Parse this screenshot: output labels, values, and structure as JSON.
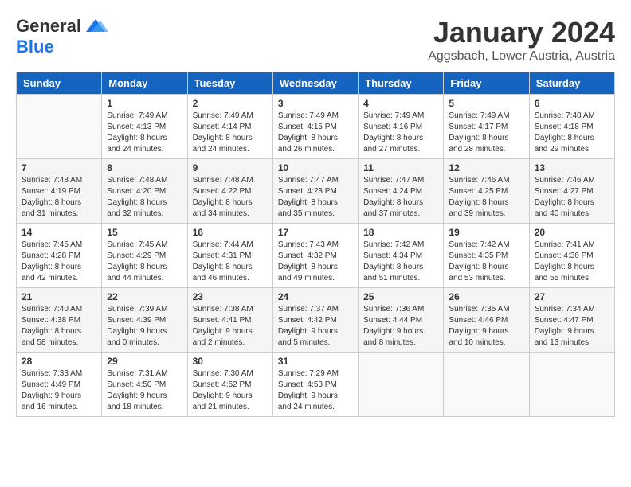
{
  "header": {
    "logo_general": "General",
    "logo_blue": "Blue",
    "month_title": "January 2024",
    "subtitle": "Aggsbach, Lower Austria, Austria"
  },
  "weekdays": [
    "Sunday",
    "Monday",
    "Tuesday",
    "Wednesday",
    "Thursday",
    "Friday",
    "Saturday"
  ],
  "weeks": [
    [
      {
        "day": "",
        "sunrise": "",
        "sunset": "",
        "daylight": ""
      },
      {
        "day": "1",
        "sunrise": "Sunrise: 7:49 AM",
        "sunset": "Sunset: 4:13 PM",
        "daylight": "Daylight: 8 hours and 24 minutes."
      },
      {
        "day": "2",
        "sunrise": "Sunrise: 7:49 AM",
        "sunset": "Sunset: 4:14 PM",
        "daylight": "Daylight: 8 hours and 24 minutes."
      },
      {
        "day": "3",
        "sunrise": "Sunrise: 7:49 AM",
        "sunset": "Sunset: 4:15 PM",
        "daylight": "Daylight: 8 hours and 26 minutes."
      },
      {
        "day": "4",
        "sunrise": "Sunrise: 7:49 AM",
        "sunset": "Sunset: 4:16 PM",
        "daylight": "Daylight: 8 hours and 27 minutes."
      },
      {
        "day": "5",
        "sunrise": "Sunrise: 7:49 AM",
        "sunset": "Sunset: 4:17 PM",
        "daylight": "Daylight: 8 hours and 28 minutes."
      },
      {
        "day": "6",
        "sunrise": "Sunrise: 7:48 AM",
        "sunset": "Sunset: 4:18 PM",
        "daylight": "Daylight: 8 hours and 29 minutes."
      }
    ],
    [
      {
        "day": "7",
        "sunrise": "Sunrise: 7:48 AM",
        "sunset": "Sunset: 4:19 PM",
        "daylight": "Daylight: 8 hours and 31 minutes."
      },
      {
        "day": "8",
        "sunrise": "Sunrise: 7:48 AM",
        "sunset": "Sunset: 4:20 PM",
        "daylight": "Daylight: 8 hours and 32 minutes."
      },
      {
        "day": "9",
        "sunrise": "Sunrise: 7:48 AM",
        "sunset": "Sunset: 4:22 PM",
        "daylight": "Daylight: 8 hours and 34 minutes."
      },
      {
        "day": "10",
        "sunrise": "Sunrise: 7:47 AM",
        "sunset": "Sunset: 4:23 PM",
        "daylight": "Daylight: 8 hours and 35 minutes."
      },
      {
        "day": "11",
        "sunrise": "Sunrise: 7:47 AM",
        "sunset": "Sunset: 4:24 PM",
        "daylight": "Daylight: 8 hours and 37 minutes."
      },
      {
        "day": "12",
        "sunrise": "Sunrise: 7:46 AM",
        "sunset": "Sunset: 4:25 PM",
        "daylight": "Daylight: 8 hours and 39 minutes."
      },
      {
        "day": "13",
        "sunrise": "Sunrise: 7:46 AM",
        "sunset": "Sunset: 4:27 PM",
        "daylight": "Daylight: 8 hours and 40 minutes."
      }
    ],
    [
      {
        "day": "14",
        "sunrise": "Sunrise: 7:45 AM",
        "sunset": "Sunset: 4:28 PM",
        "daylight": "Daylight: 8 hours and 42 minutes."
      },
      {
        "day": "15",
        "sunrise": "Sunrise: 7:45 AM",
        "sunset": "Sunset: 4:29 PM",
        "daylight": "Daylight: 8 hours and 44 minutes."
      },
      {
        "day": "16",
        "sunrise": "Sunrise: 7:44 AM",
        "sunset": "Sunset: 4:31 PM",
        "daylight": "Daylight: 8 hours and 46 minutes."
      },
      {
        "day": "17",
        "sunrise": "Sunrise: 7:43 AM",
        "sunset": "Sunset: 4:32 PM",
        "daylight": "Daylight: 8 hours and 49 minutes."
      },
      {
        "day": "18",
        "sunrise": "Sunrise: 7:42 AM",
        "sunset": "Sunset: 4:34 PM",
        "daylight": "Daylight: 8 hours and 51 minutes."
      },
      {
        "day": "19",
        "sunrise": "Sunrise: 7:42 AM",
        "sunset": "Sunset: 4:35 PM",
        "daylight": "Daylight: 8 hours and 53 minutes."
      },
      {
        "day": "20",
        "sunrise": "Sunrise: 7:41 AM",
        "sunset": "Sunset: 4:36 PM",
        "daylight": "Daylight: 8 hours and 55 minutes."
      }
    ],
    [
      {
        "day": "21",
        "sunrise": "Sunrise: 7:40 AM",
        "sunset": "Sunset: 4:38 PM",
        "daylight": "Daylight: 8 hours and 58 minutes."
      },
      {
        "day": "22",
        "sunrise": "Sunrise: 7:39 AM",
        "sunset": "Sunset: 4:39 PM",
        "daylight": "Daylight: 9 hours and 0 minutes."
      },
      {
        "day": "23",
        "sunrise": "Sunrise: 7:38 AM",
        "sunset": "Sunset: 4:41 PM",
        "daylight": "Daylight: 9 hours and 2 minutes."
      },
      {
        "day": "24",
        "sunrise": "Sunrise: 7:37 AM",
        "sunset": "Sunset: 4:42 PM",
        "daylight": "Daylight: 9 hours and 5 minutes."
      },
      {
        "day": "25",
        "sunrise": "Sunrise: 7:36 AM",
        "sunset": "Sunset: 4:44 PM",
        "daylight": "Daylight: 9 hours and 8 minutes."
      },
      {
        "day": "26",
        "sunrise": "Sunrise: 7:35 AM",
        "sunset": "Sunset: 4:46 PM",
        "daylight": "Daylight: 9 hours and 10 minutes."
      },
      {
        "day": "27",
        "sunrise": "Sunrise: 7:34 AM",
        "sunset": "Sunset: 4:47 PM",
        "daylight": "Daylight: 9 hours and 13 minutes."
      }
    ],
    [
      {
        "day": "28",
        "sunrise": "Sunrise: 7:33 AM",
        "sunset": "Sunset: 4:49 PM",
        "daylight": "Daylight: 9 hours and 16 minutes."
      },
      {
        "day": "29",
        "sunrise": "Sunrise: 7:31 AM",
        "sunset": "Sunset: 4:50 PM",
        "daylight": "Daylight: 9 hours and 18 minutes."
      },
      {
        "day": "30",
        "sunrise": "Sunrise: 7:30 AM",
        "sunset": "Sunset: 4:52 PM",
        "daylight": "Daylight: 9 hours and 21 minutes."
      },
      {
        "day": "31",
        "sunrise": "Sunrise: 7:29 AM",
        "sunset": "Sunset: 4:53 PM",
        "daylight": "Daylight: 9 hours and 24 minutes."
      },
      {
        "day": "",
        "sunrise": "",
        "sunset": "",
        "daylight": ""
      },
      {
        "day": "",
        "sunrise": "",
        "sunset": "",
        "daylight": ""
      },
      {
        "day": "",
        "sunrise": "",
        "sunset": "",
        "daylight": ""
      }
    ]
  ]
}
